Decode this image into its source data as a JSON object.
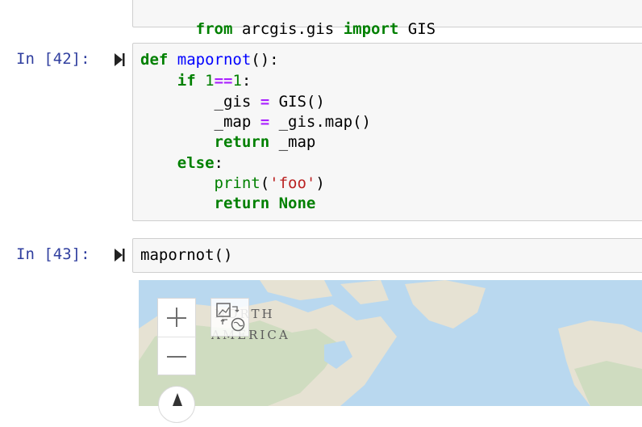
{
  "cell_41": {
    "code_parts": [
      "from",
      " arcgis.gis ",
      "import",
      " GIS"
    ]
  },
  "cell_42": {
    "prompt": "In [42]:",
    "line1": {
      "kw": "def",
      "fn": "mapornot",
      "rest": "():"
    },
    "line2": {
      "kw": "if",
      "num1": "1",
      "op": "==",
      "num2": "1",
      "rest": ":"
    },
    "line3": {
      "left": "_gis ",
      "op": "=",
      "right": " GIS()"
    },
    "line4": {
      "left": "_map ",
      "op": "=",
      "right": " _gis.map()"
    },
    "line5": {
      "kw": "return",
      "rest": " _map"
    },
    "line6": {
      "kw": "else",
      "rest": ":"
    },
    "line7": {
      "fn": "print",
      "open": "(",
      "str": "'foo'",
      "close": ")"
    },
    "line8": {
      "kw": "return",
      "rest": " ",
      "kw2": "None"
    }
  },
  "cell_43": {
    "prompt": "In [43]:",
    "code": "mapornot()"
  },
  "map": {
    "label_line1": "NORTH",
    "label_line2": "AMERICA",
    "land_color": "#e6e2d3",
    "water_color": "#b9d8ef",
    "forest_color": "#cfdcc0"
  },
  "icons": {
    "run": "run-cell-icon",
    "zoom_in": "zoom-in-icon",
    "zoom_out": "zoom-out-icon",
    "basemap": "basemap-toggle-icon",
    "compass": "compass-icon"
  }
}
